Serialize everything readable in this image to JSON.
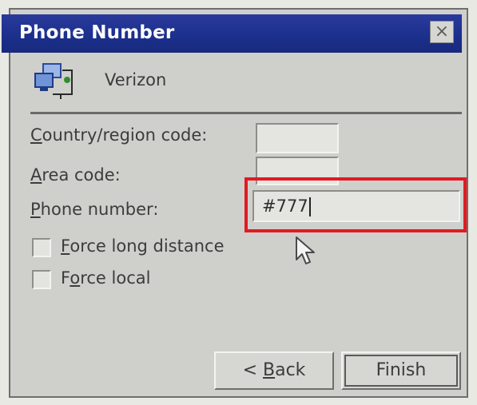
{
  "window": {
    "title": "Phone Number",
    "close_glyph": "×"
  },
  "header": {
    "connection_name": "Verizon",
    "icon": "network-connection-icon"
  },
  "form": {
    "country_code": {
      "label_mnemonic": "C",
      "label_rest": "ountry/region code:",
      "value": ""
    },
    "area_code": {
      "label_mnemonic": "A",
      "label_rest": "rea code:",
      "value": ""
    },
    "phone_number": {
      "label_mnemonic": "P",
      "label_rest": "hone number:",
      "value": "#777"
    },
    "force_long_distance": {
      "label_mnemonic": "F",
      "label_rest": "orce long distance",
      "checked": false
    },
    "force_local": {
      "label_prefix": "F",
      "label_mnemonic": "o",
      "label_rest": "rce local",
      "checked": false
    }
  },
  "buttons": {
    "back_prefix": "< ",
    "back_mnemonic": "B",
    "back_rest": "ack",
    "finish_label": "Finish"
  },
  "colors": {
    "titlebar": "#1b2f8c",
    "highlight_box": "#e11b22"
  }
}
